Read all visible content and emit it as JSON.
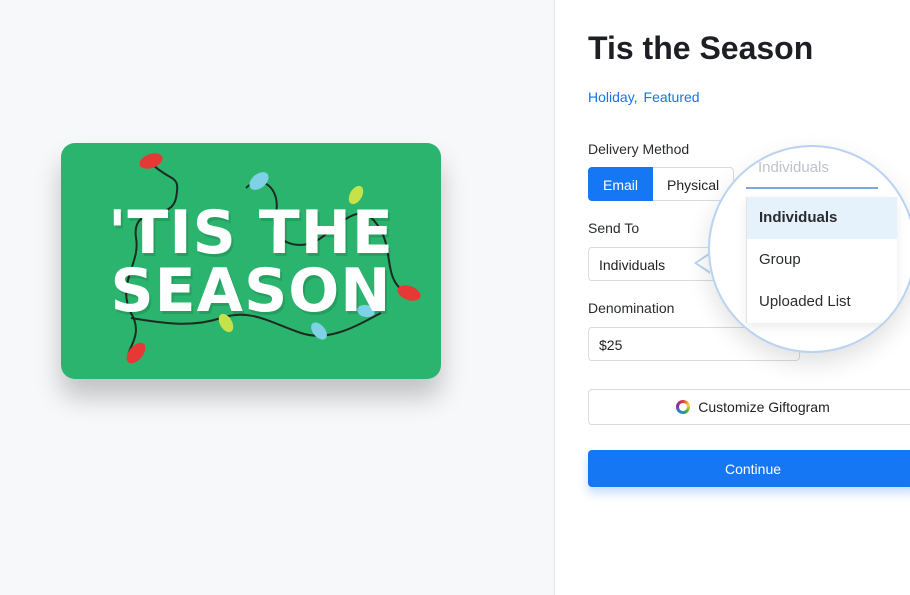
{
  "card": {
    "line1": "'TIS THE",
    "line2": "SEASON"
  },
  "title": "Tis the Season",
  "tags": [
    "Holiday",
    "Featured"
  ],
  "delivery": {
    "label": "Delivery Method",
    "options": [
      "Email",
      "Physical"
    ],
    "selected": "Email"
  },
  "send_to": {
    "label": "Send To",
    "value": "Individuals"
  },
  "denomination": {
    "label": "Denomination",
    "value": "$25"
  },
  "customize_label": "Customize Giftogram",
  "continue_label": "Continue",
  "magnifier": {
    "input_text": "Individuals",
    "options": [
      "Individuals",
      "Group",
      "Uploaded List"
    ],
    "selected": "Individuals"
  },
  "colors": {
    "card_green": "#2bb46e",
    "accent_blue": "#1677f5",
    "link_blue": "#1a73e8"
  }
}
